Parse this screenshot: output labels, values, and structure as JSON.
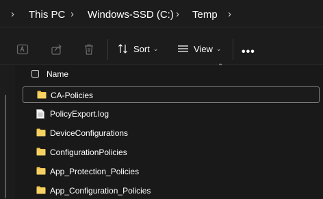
{
  "breadcrumb": {
    "items": [
      "This PC",
      "Windows-SSD (C:)",
      "Temp"
    ]
  },
  "toolbar": {
    "sort_label": "Sort",
    "view_label": "View",
    "more_label": "•••"
  },
  "list": {
    "column_name": "Name",
    "items": [
      {
        "name": "CA-Policies",
        "icon": "folder-icon",
        "selected": true
      },
      {
        "name": "PolicyExport.log",
        "icon": "text-file-icon",
        "selected": false
      },
      {
        "name": "DeviceConfigurations",
        "icon": "folder-icon",
        "selected": false
      },
      {
        "name": "ConfigurationPolicies",
        "icon": "folder-icon",
        "selected": false
      },
      {
        "name": "App_Protection_Policies",
        "icon": "folder-icon",
        "selected": false
      },
      {
        "name": "App_Configuration_Policies",
        "icon": "folder-icon",
        "selected": false
      }
    ]
  },
  "colors": {
    "background": "#1c1c1c",
    "list_background": "#191919",
    "folder": "#f2c44d",
    "selection_border": "#7f7f7f"
  }
}
